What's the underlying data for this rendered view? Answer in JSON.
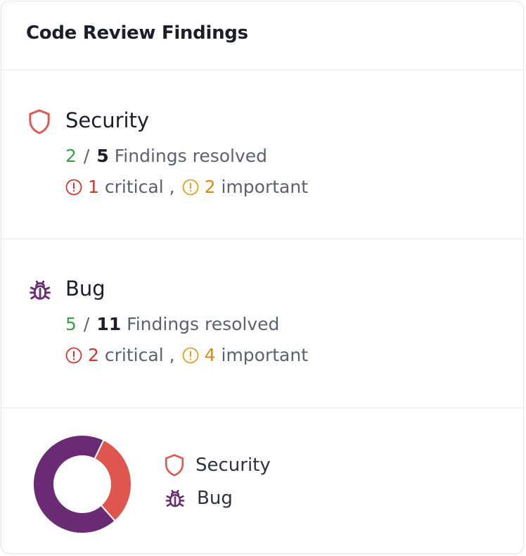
{
  "title": "Code Review Findings",
  "categories": [
    {
      "name": "Security",
      "icon": "shield-icon",
      "resolved": "2",
      "total": "5",
      "resolved_label": "Findings resolved",
      "critical_count": "1",
      "critical_label": "critical",
      "important_count": "2",
      "important_label": "important"
    },
    {
      "name": "Bug",
      "icon": "bug-icon",
      "resolved": "5",
      "total": "11",
      "resolved_label": "Findings resolved",
      "critical_count": "2",
      "critical_label": "critical",
      "important_count": "4",
      "important_label": "important"
    }
  ],
  "chart_data": {
    "type": "pie",
    "categories": [
      "Security",
      "Bug"
    ],
    "values": [
      5,
      11
    ],
    "colors": [
      "#e0564f",
      "#6a2b74"
    ]
  },
  "colors": {
    "security": "#e0564f",
    "bug": "#6a2b74",
    "resolved_green": "#3ba04a",
    "critical_red": "#d6332d",
    "important_orange": "#d98b12"
  },
  "legend": [
    {
      "label": "Security",
      "icon": "shield-icon"
    },
    {
      "label": "Bug",
      "icon": "bug-icon"
    }
  ]
}
